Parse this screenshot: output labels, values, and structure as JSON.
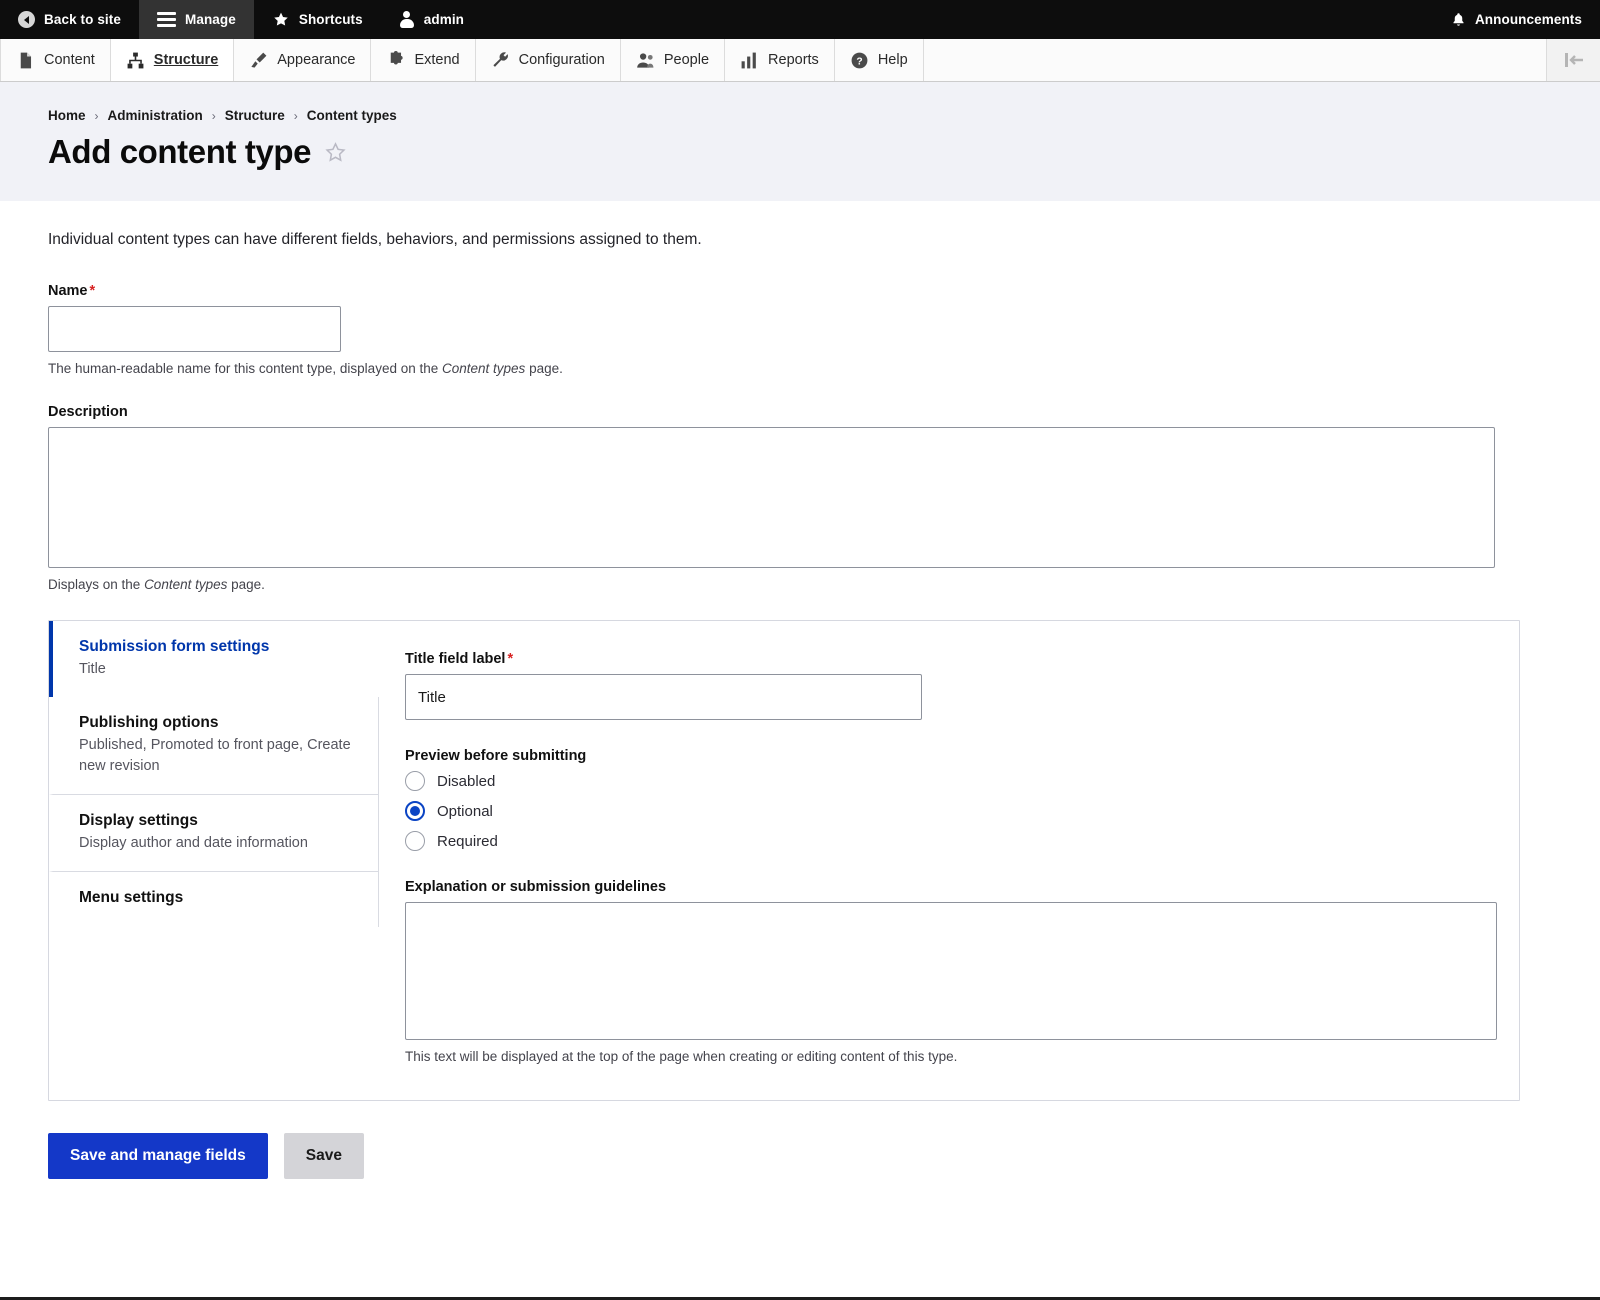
{
  "toolbar": {
    "back_to_site": "Back to site",
    "manage": "Manage",
    "shortcuts": "Shortcuts",
    "user": "admin",
    "announcements": "Announcements",
    "icons": {
      "back": "back-arrow-circle-icon",
      "manage": "hamburger-icon",
      "shortcuts": "star-icon",
      "user": "person-icon",
      "announcements": "bell-icon"
    }
  },
  "admin_menu": {
    "items": [
      {
        "label": "Content",
        "icon": "file-icon",
        "active": false
      },
      {
        "label": "Structure",
        "icon": "structure-icon",
        "active": true
      },
      {
        "label": "Appearance",
        "icon": "paintbrush-icon",
        "active": false
      },
      {
        "label": "Extend",
        "icon": "puzzle-icon",
        "active": false
      },
      {
        "label": "Configuration",
        "icon": "wrench-icon",
        "active": false
      },
      {
        "label": "People",
        "icon": "people-icon",
        "active": false
      },
      {
        "label": "Reports",
        "icon": "bar-chart-icon",
        "active": false
      },
      {
        "label": "Help",
        "icon": "question-circle-icon",
        "active": false
      }
    ],
    "toggle_icon": "toolbar-orientation-toggle-icon"
  },
  "breadcrumb": {
    "items": [
      "Home",
      "Administration",
      "Structure",
      "Content types"
    ],
    "separator": "›"
  },
  "page": {
    "title": "Add content type",
    "bookmark_icon": "star-outline-icon",
    "intro": "Individual content types can have different fields, behaviors, and permissions assigned to them."
  },
  "form": {
    "name": {
      "label": "Name",
      "required_marker": "*",
      "value": "",
      "help_before": "The human-readable name for this content type, displayed on the ",
      "help_italic": "Content types",
      "help_after": " page."
    },
    "description": {
      "label": "Description",
      "value": "",
      "help_before": "Displays on the ",
      "help_italic": "Content types",
      "help_after": " page."
    }
  },
  "vertical_tabs": [
    {
      "title": "Submission form settings",
      "summary": "Title",
      "active": true
    },
    {
      "title": "Publishing options",
      "summary": "Published, Promoted to front page, Create new revision",
      "active": false
    },
    {
      "title": "Display settings",
      "summary": "Display author and date information",
      "active": false
    },
    {
      "title": "Menu settings",
      "summary": "",
      "active": false
    }
  ],
  "panel": {
    "title_field": {
      "label": "Title field label",
      "required_marker": "*",
      "value": "Title"
    },
    "preview": {
      "label": "Preview before submitting",
      "options": [
        "Disabled",
        "Optional",
        "Required"
      ],
      "selected": "Optional"
    },
    "explanation": {
      "label": "Explanation or submission guidelines",
      "value": "",
      "help": "This text will be displayed at the top of the page when creating or editing content of this type."
    }
  },
  "actions": {
    "primary": "Save and manage fields",
    "secondary": "Save"
  },
  "colors": {
    "accent_blue": "#1438c8",
    "active_tab_blue": "#0036ab",
    "radio_blue": "#0b44c4",
    "required_red": "#d72222",
    "toolbar_black": "#0d0d0d",
    "header_band": "#f1f2f7"
  }
}
